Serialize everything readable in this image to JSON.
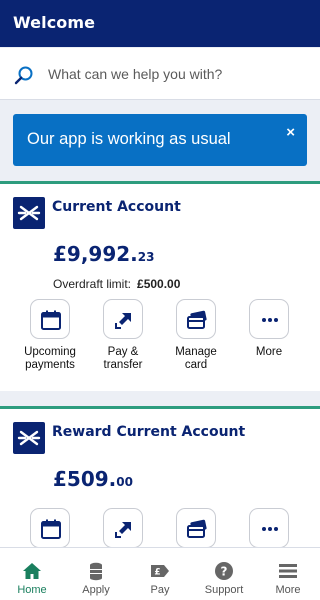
{
  "header": {
    "title": "Welcome"
  },
  "search": {
    "placeholder": "What can we help you with?"
  },
  "banner": {
    "text": "Our app is working as usual",
    "close_glyph": "×"
  },
  "accounts": [
    {
      "name": "Current Account",
      "balance_main": "£9,992.",
      "balance_pence": "23",
      "overdraft_label": "Overdraft limit:",
      "overdraft_value": "£500.00",
      "actions": [
        {
          "label": "Upcoming payments",
          "icon": "calendar-icon"
        },
        {
          "label": "Pay & transfer",
          "icon": "transfer-arrows-icon"
        },
        {
          "label": "Manage card",
          "icon": "card-icon"
        },
        {
          "label": "More",
          "icon": "ellipsis-icon"
        }
      ]
    },
    {
      "name": "Reward Current Account",
      "balance_main": "£509.",
      "balance_pence": "00",
      "actions": [
        {
          "icon": "calendar-icon"
        },
        {
          "icon": "transfer-arrows-icon"
        },
        {
          "icon": "card-icon"
        },
        {
          "icon": "ellipsis-icon"
        }
      ]
    }
  ],
  "tabbar": {
    "items": [
      {
        "label": "Home",
        "icon": "home-icon",
        "active": true
      },
      {
        "label": "Apply",
        "icon": "coins-icon",
        "active": false
      },
      {
        "label": "Pay",
        "icon": "pay-icon",
        "active": false
      },
      {
        "label": "Support",
        "icon": "question-icon",
        "active": false
      },
      {
        "label": "More",
        "icon": "menu-icon",
        "active": false
      }
    ]
  },
  "colors": {
    "header": "#0a2472",
    "banner": "#0870c4",
    "accent_green": "#2d9c7e",
    "active_tab": "#1a7f5e"
  }
}
